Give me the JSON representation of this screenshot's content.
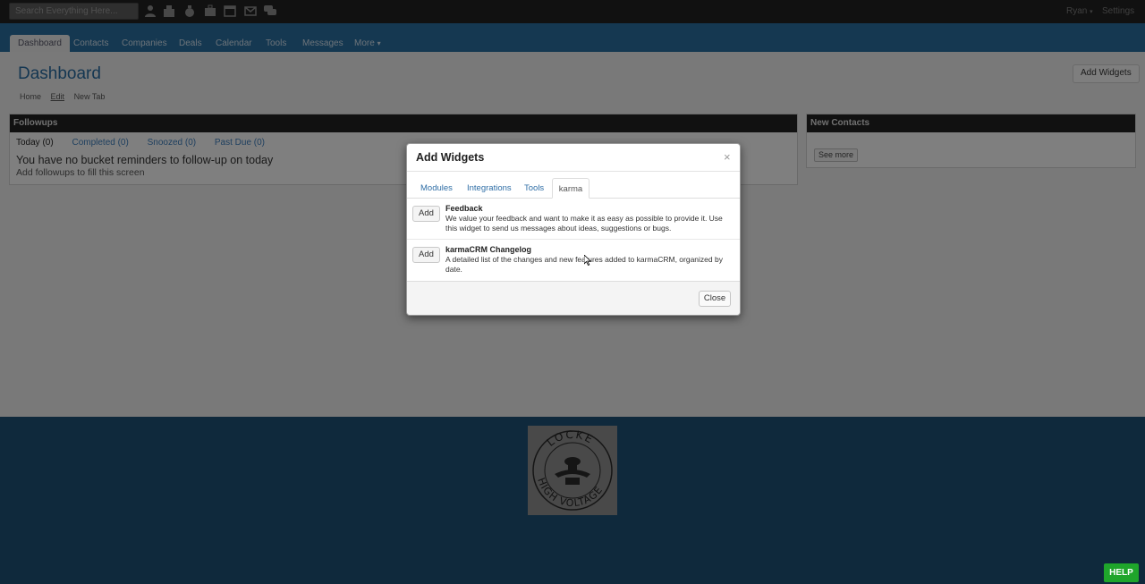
{
  "topbar": {
    "search_placeholder": "Search Everything Here...",
    "icons": [
      "person-icon",
      "building-icon",
      "money-bag-icon",
      "briefcase-icon",
      "calendar-icon",
      "envelope-icon",
      "chat-icon"
    ],
    "user_menu": "Ryan",
    "settings": "Settings"
  },
  "nav": {
    "tabs": [
      "Dashboard",
      "Contacts",
      "Companies",
      "Deals",
      "Calendar",
      "Tools",
      "Messages",
      "More"
    ]
  },
  "page": {
    "title": "Dashboard",
    "add_widgets": "Add Widgets",
    "subtabs": {
      "home": "Home",
      "edit": "Edit",
      "new_tab": "New Tab"
    }
  },
  "followups": {
    "title": "Followups",
    "tabs": [
      "Today (0)",
      "Completed (0)",
      "Snoozed (0)",
      "Past Due (0)"
    ],
    "empty_message": "You have no bucket reminders to follow-up on today",
    "hint": "Add followups to fill this screen"
  },
  "new_contacts": {
    "title": "New Contacts",
    "see_more": "See more"
  },
  "modal": {
    "title": "Add Widgets",
    "close_icon": "×",
    "tabs": [
      "Modules",
      "Integrations",
      "Tools",
      "karma"
    ],
    "active_tab": "karma",
    "widgets": [
      {
        "add_label": "Add",
        "name": "Feedback",
        "description": "We value your feedback and want to make it as easy as possible to provide it. Use this widget to send us messages about ideas, suggestions or bugs."
      },
      {
        "add_label": "Add",
        "name": "karmaCRM Changelog",
        "description": "A detailed list of the changes and new features added to karmaCRM, organized by date."
      }
    ],
    "close_label": "Close"
  },
  "footer": {
    "logo_text_top": "LOCKE",
    "logo_text_bottom": "HIGH VOLTAGE",
    "help_label": "HELP",
    "help_color": "#1fa52b"
  },
  "colors": {
    "brand_blue": "#2a6c9c",
    "link_blue": "#2f6ea6"
  }
}
